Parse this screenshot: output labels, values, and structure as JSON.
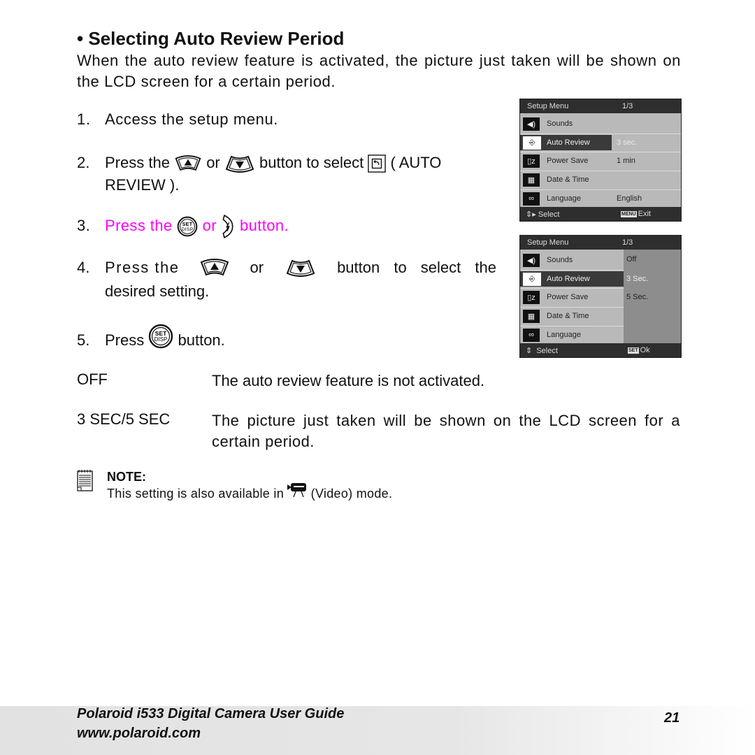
{
  "section": {
    "title": "• Selecting Auto Review Period",
    "intro": "When the auto review feature is activated, the picture just taken will be shown on the LCD screen for a certain period."
  },
  "steps": [
    {
      "num": "1.",
      "text": "Access the setup menu."
    },
    {
      "num": "2.",
      "pre": "Press the",
      "or": "or",
      "mid": "button to select",
      "post": "( AUTO",
      "cont": "REVIEW )."
    },
    {
      "num": "3.",
      "pre": "Press the",
      "or": "or",
      "post": "button.",
      "highlight_color": "#ff00ff"
    },
    {
      "num": "4.",
      "pre": "Press the",
      "or": "or",
      "mid": "button to select the",
      "cont": "desired setting."
    },
    {
      "num": "5.",
      "pre": "Press",
      "post": "button."
    }
  ],
  "options": [
    {
      "key": "OFF",
      "desc": "The auto review feature is not activated."
    },
    {
      "key": "3 SEC/5 SEC",
      "desc": "The picture just taken will be shown on the LCD screen for a certain period."
    }
  ],
  "note": {
    "heading": "NOTE:",
    "pre": "This setting is also available in",
    "post": "(Video) mode."
  },
  "lcd1": {
    "title": "Setup Menu",
    "page": "1/3",
    "rows": [
      {
        "icon": "sound-icon",
        "label": "Sounds",
        "value": ""
      },
      {
        "icon": "auto-review-icon",
        "label": "Auto Review",
        "value": "3 sec.",
        "selected": true
      },
      {
        "icon": "power-save-icon",
        "label": "Power Save",
        "value": "1 min"
      },
      {
        "icon": "date-time-icon",
        "label": "Date & Time",
        "value": ""
      },
      {
        "icon": "language-icon",
        "label": "Language",
        "value": "English"
      }
    ],
    "footer_select": "Select",
    "footer_badge": "MENU",
    "footer_action": "Exit"
  },
  "lcd2": {
    "title": "Setup Menu",
    "page": "1/3",
    "rows": [
      {
        "icon": "sound-icon",
        "label": "Sounds"
      },
      {
        "icon": "auto-review-icon",
        "label": "Auto Review",
        "selected": true
      },
      {
        "icon": "power-save-icon",
        "label": "Power Save"
      },
      {
        "icon": "date-time-icon",
        "label": "Date & Time"
      },
      {
        "icon": "language-icon",
        "label": "Language"
      }
    ],
    "submenu": [
      "Off",
      "3 Sec.",
      "5 Sec."
    ],
    "submenu_selected": "3 Sec.",
    "footer_select": "Select",
    "footer_badge": "SET",
    "footer_action": "Ok"
  },
  "footer": {
    "title": "Polaroid i533 Digital Camera User Guide",
    "url": "www.polaroid.com",
    "page": "21"
  },
  "colors": {
    "highlight": "#ff00ff",
    "lcd_bg": "#b9b9b9",
    "lcd_bar": "#2e2e2e"
  }
}
